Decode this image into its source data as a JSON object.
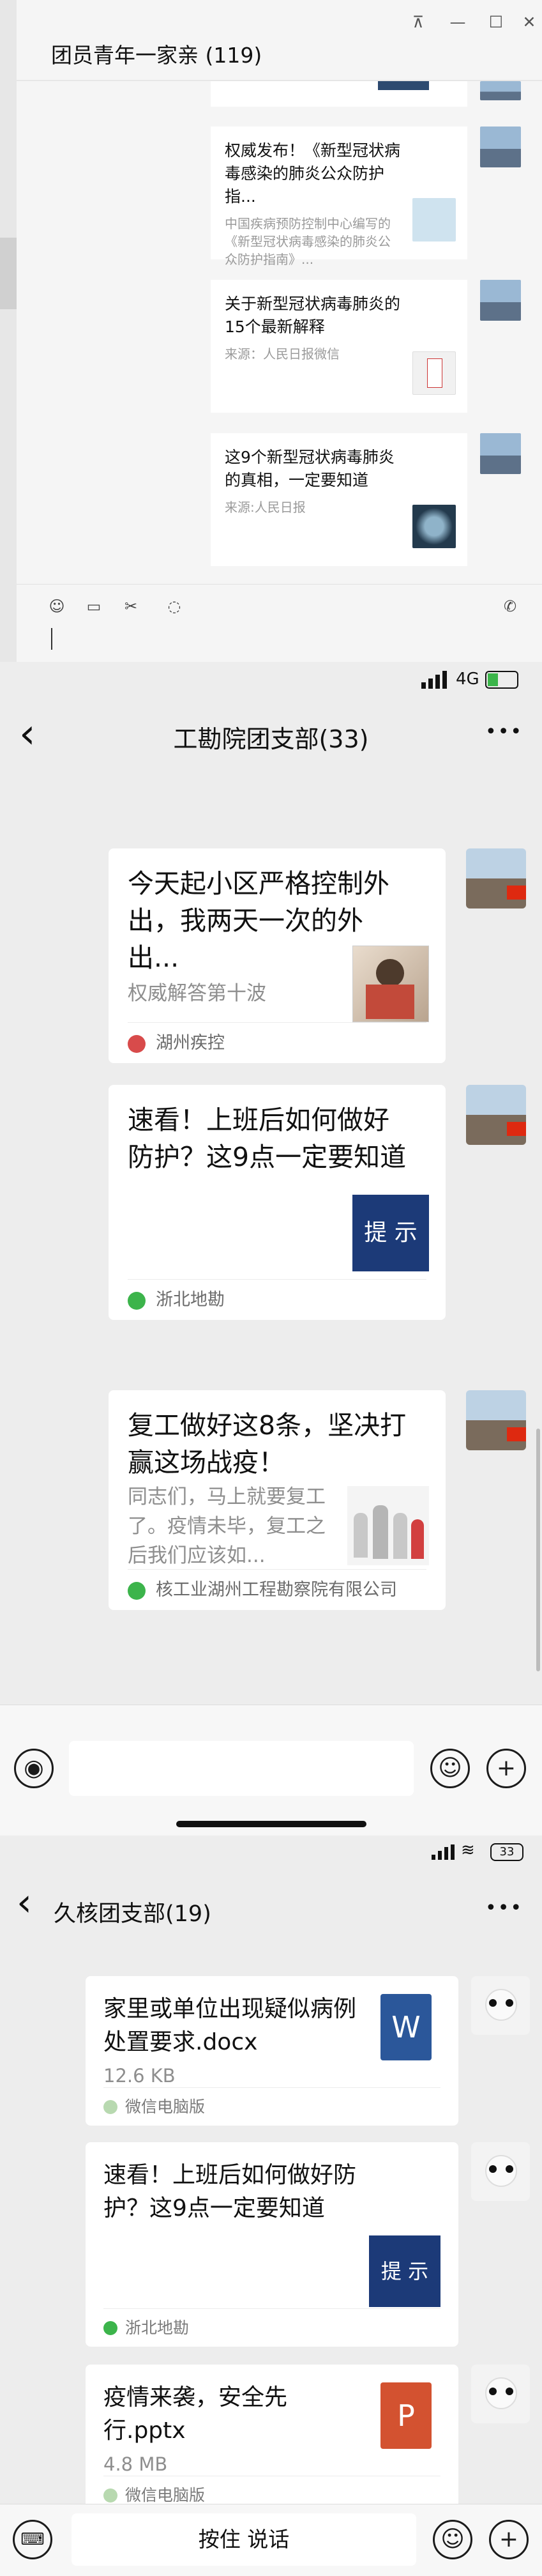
{
  "section1": {
    "title": "团员青年一家亲 (119)",
    "window_controls": [
      "⊼",
      "—",
      "☐",
      "✕"
    ],
    "messages": [
      {
        "title": "权威发布！《新型冠状病毒感染的肺炎公众防护指...",
        "desc": "中国疾病预防控制中心编写的《新型冠状病毒感染的肺炎公众防护指南》...",
        "thumb_color": "#cfe3ef"
      },
      {
        "title": "关于新型冠状病毒肺炎的15个最新解释",
        "desc": "来源：人民日报微信",
        "thumb_color": "#f1f1f1"
      },
      {
        "title": "这9个新型冠状病毒肺炎的真相，一定要知道",
        "desc": "来源:人民日报",
        "thumb_color": "#233a4d"
      }
    ],
    "toolbar_icons": [
      "emoji-icon",
      "folder-icon",
      "scissors-icon",
      "chat-history-icon",
      "phone-icon"
    ]
  },
  "section2": {
    "status": {
      "signal": "4G"
    },
    "title": "工勘院团支部(33)",
    "more": "•••",
    "back": "‹",
    "messages": [
      {
        "title": "今天起小区严格控制外出，我两天一次的外出...",
        "desc": "权威解答第十波",
        "source": "湖州疾控",
        "source_color": "#d84b4b"
      },
      {
        "title": "速看！上班后如何做好防护？这9点一定要知道",
        "desc": "",
        "thumb_text": "提 示",
        "source": "浙北地勘",
        "source_color": "#3cb44b"
      },
      {
        "title": "复工做好这8条，坚决打赢这场战疫！",
        "desc": "同志们，马上就要复工了。疫情未毕，复工之后我们应该如...",
        "source": "核工业湖州工程勘察院有限公司",
        "source_color": "#3cb44b"
      }
    ]
  },
  "section3": {
    "title": "久核团支部(19)",
    "more": "•••",
    "back": "‹",
    "battery": "33",
    "messages": [
      {
        "title": "家里或单位出现疑似病例处置要求.docx",
        "size": "12.6 KB",
        "file_letter": "W",
        "file_color": "#2b579a",
        "source": "微信电脑版"
      },
      {
        "title": "速看！上班后如何做好防护？这9点一定要知道",
        "thumb_text": "提 示",
        "source": "浙北地勘"
      },
      {
        "title": "疫情来袭，安全先行.pptx",
        "size": "4.8 MB",
        "file_letter": "P",
        "file_color": "#d35230",
        "source": "微信电脑版"
      }
    ],
    "press_to_talk": "按住 说话"
  }
}
